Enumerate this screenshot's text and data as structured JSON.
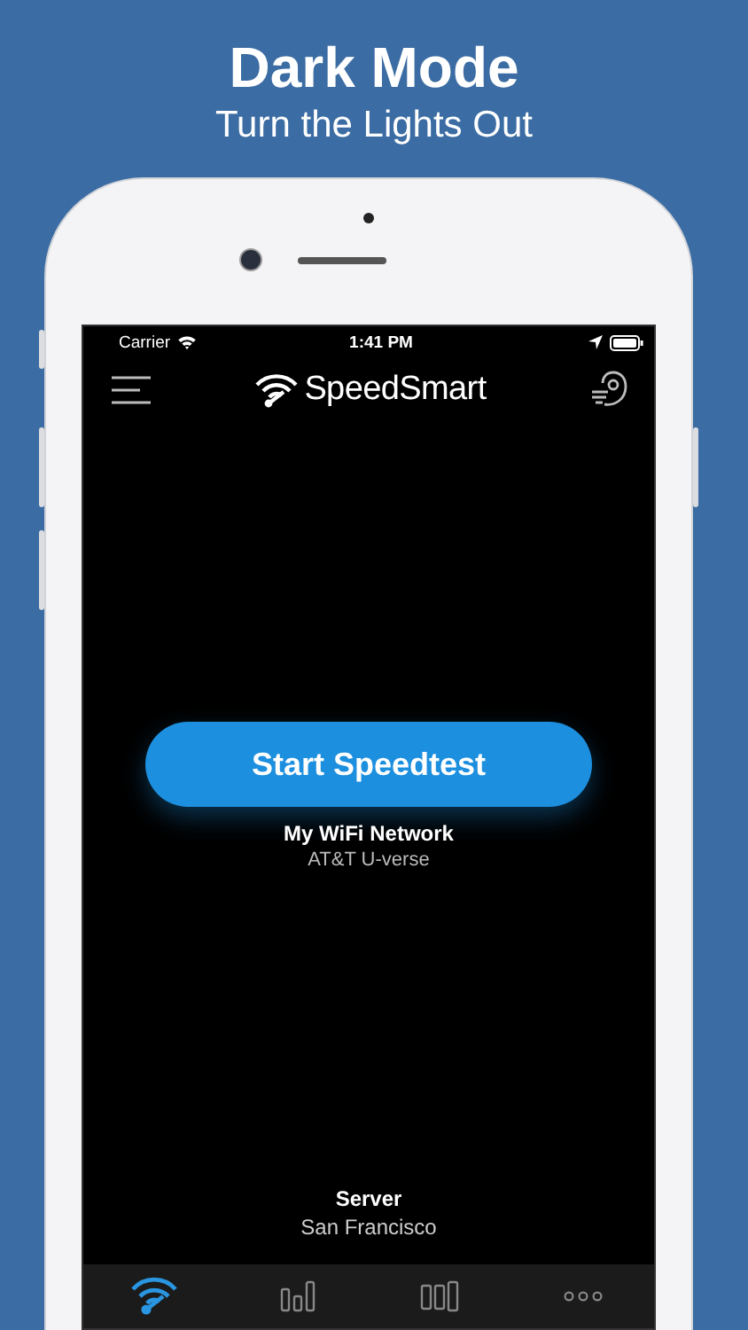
{
  "headline": {
    "title": "Dark Mode",
    "subtitle": "Turn the Lights Out"
  },
  "status_bar": {
    "carrier": "Carrier",
    "time": "1:41 PM"
  },
  "app_bar": {
    "title": "SpeedSmart"
  },
  "start_button": {
    "label": "Start Speedtest"
  },
  "network": {
    "name": "My WiFi Network",
    "provider": "AT&T U-verse"
  },
  "server": {
    "label": "Server",
    "location": "San Francisco"
  },
  "tabs": [
    {
      "kind": "wifi",
      "selected": true
    },
    {
      "kind": "results",
      "selected": false
    },
    {
      "kind": "columns",
      "selected": false
    },
    {
      "kind": "more",
      "selected": false
    }
  ]
}
